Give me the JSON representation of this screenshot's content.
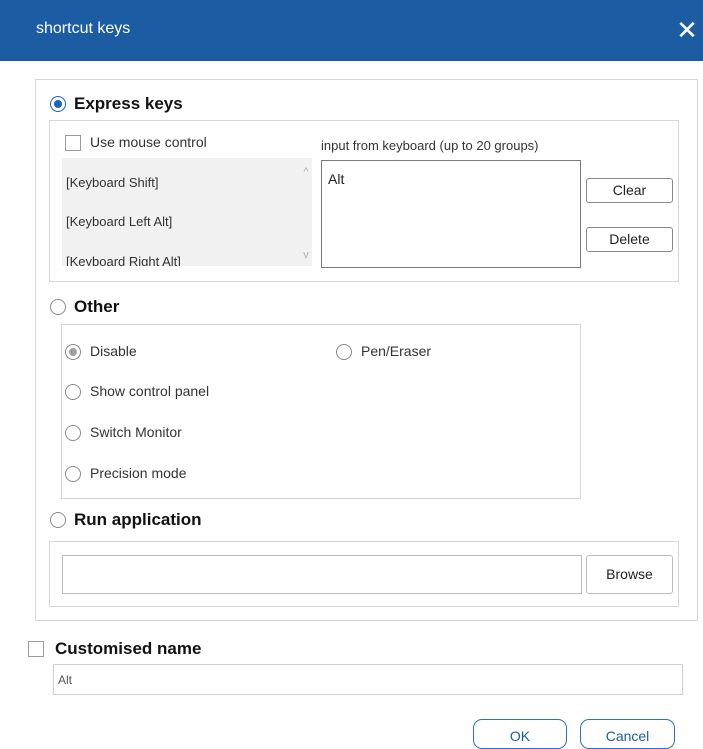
{
  "window": {
    "title": "shortcut keys",
    "close_glyph": "✕"
  },
  "express_keys": {
    "label": "Express keys",
    "selected": true,
    "use_mouse_control_label": "Use mouse control",
    "use_mouse_control_checked": false,
    "key_list": [
      "[Keyboard Shift]",
      "[Keyboard Left Alt]",
      "[Keyboard Right Alt]"
    ],
    "scroll_up_glyph": "^",
    "scroll_down_glyph": "v",
    "input_label": "input from keyboard (up to 20 groups)",
    "input_value": "Alt",
    "clear_label": "Clear",
    "delete_label": "Delete"
  },
  "other": {
    "label": "Other",
    "selected": false,
    "options": {
      "disable": "Disable",
      "pen_eraser": "Pen/Eraser",
      "show_control_panel": "Show control panel",
      "switch_monitor": "Switch Monitor",
      "precision_mode": "Precision mode"
    },
    "selected_option": "Disable"
  },
  "run_application": {
    "label": "Run application",
    "selected": false,
    "path_value": "",
    "browse_label": "Browse"
  },
  "customised_name": {
    "label": "Customised name",
    "checked": false,
    "value": "Alt"
  },
  "footer": {
    "ok_label": "OK",
    "cancel_label": "Cancel"
  },
  "colors": {
    "titlebar": "#1c5ca3",
    "accent": "#1c64c8",
    "border": "#d6d6d6"
  },
  "icons": {
    "close": "close-icon",
    "scroll_up": "chevron-up-icon",
    "scroll_down": "chevron-down-icon"
  }
}
